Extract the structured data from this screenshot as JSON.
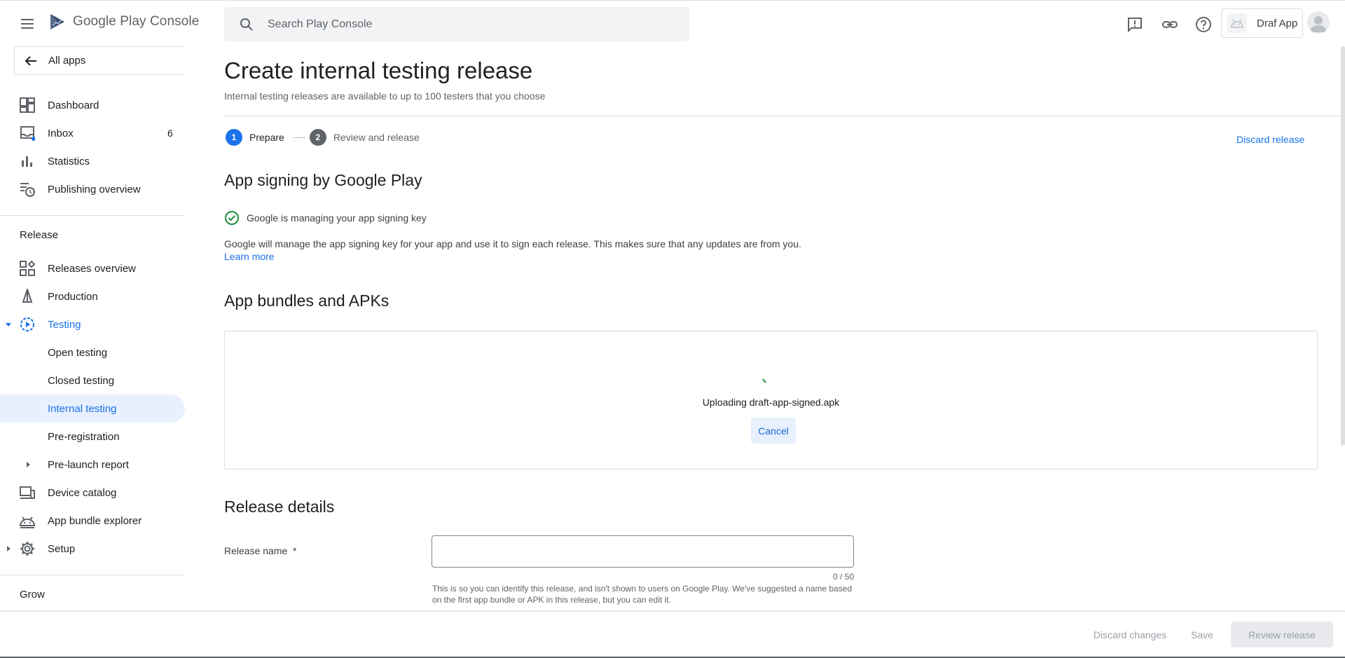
{
  "header": {
    "logo_text": "Google Play Console",
    "search_placeholder": "Search Play Console",
    "app_name": "Draf App"
  },
  "sidebar": {
    "all_apps": "All apps",
    "items_top": [
      {
        "label": "Dashboard"
      },
      {
        "label": "Inbox",
        "count": "6"
      },
      {
        "label": "Statistics"
      },
      {
        "label": "Publishing overview"
      }
    ],
    "section_release": "Release",
    "release_items": [
      {
        "label": "Releases overview"
      },
      {
        "label": "Production"
      },
      {
        "label": "Testing"
      },
      {
        "label": "Open testing"
      },
      {
        "label": "Closed testing"
      },
      {
        "label": "Internal testing"
      },
      {
        "label": "Pre-registration"
      },
      {
        "label": "Pre-launch report"
      },
      {
        "label": "Device catalog"
      },
      {
        "label": "App bundle explorer"
      },
      {
        "label": "Setup"
      }
    ],
    "section_grow": "Grow"
  },
  "main": {
    "title": "Create internal testing release",
    "subtitle": "Internal testing releases are available to up to 100 testers that you choose",
    "steps": [
      {
        "number": "1",
        "label": "Prepare",
        "color": "#1a73e8"
      },
      {
        "number": "2",
        "label": "Review and release",
        "color": "#5f6368"
      }
    ],
    "discard_release": "Discard release",
    "signing": {
      "heading": "App signing by Google Play",
      "status": "Google is managing your app signing key",
      "description": "Google will manage the app signing key for your app and use it to sign each release. This makes sure that any updates are from you.",
      "learn_more": "Learn more"
    },
    "bundles": {
      "heading": "App bundles and APKs",
      "uploading_prefix": "Uploading",
      "filename": "draft-app-signed.apk",
      "cancel": "Cancel"
    },
    "details": {
      "heading": "Release details",
      "release_name_label": "Release name  *",
      "release_name_value": "",
      "char_count": "0 / 50",
      "help_text": "This is so you can identify this release, and isn't shown to users on Google Play. We've suggested a name based on the first app bundle or APK in this release, but you can edit it."
    }
  },
  "footer": {
    "discard_changes": "Discard changes",
    "save": "Save",
    "review_release": "Review release"
  },
  "colors": {
    "accent": "#1a73e8",
    "active_bg": "#e8f0fe",
    "success": "#1e8e3e"
  }
}
